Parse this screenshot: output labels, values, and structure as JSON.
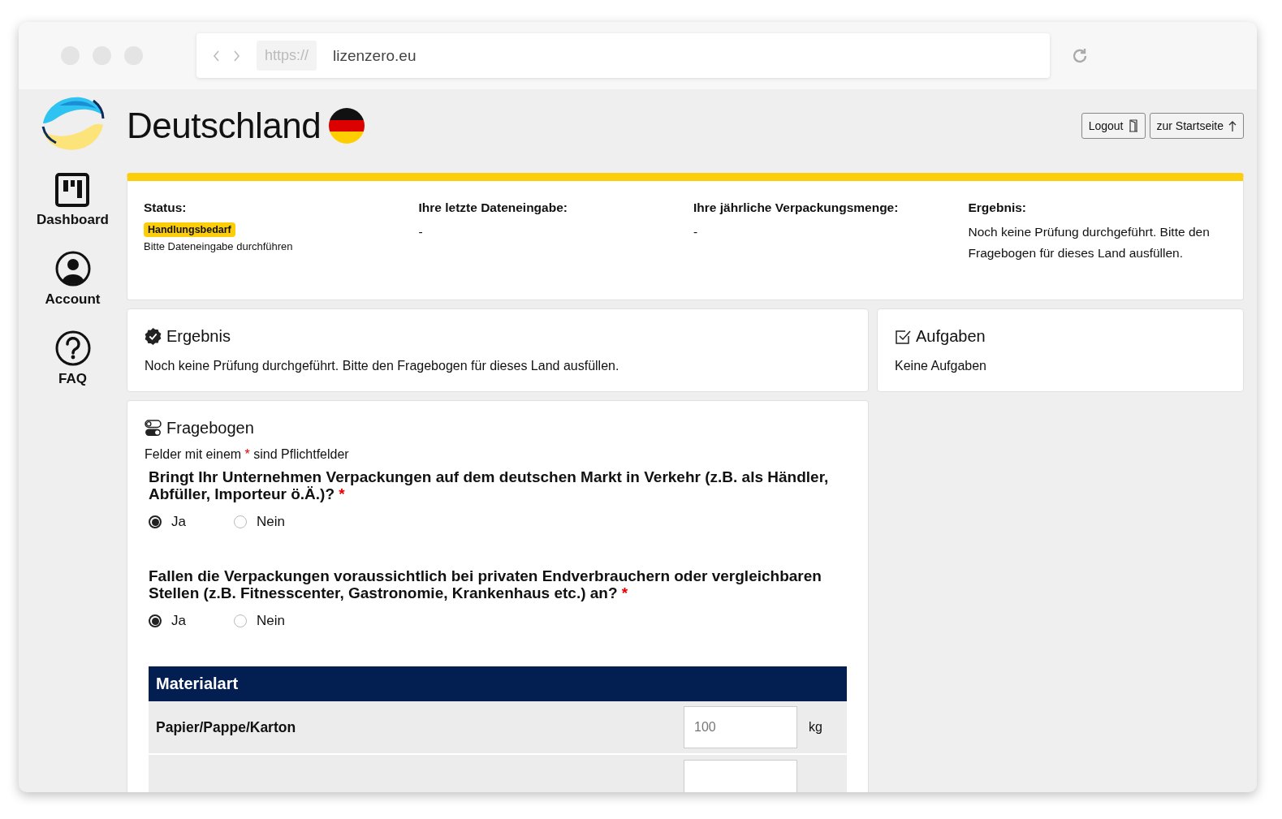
{
  "browser": {
    "scheme": "https://",
    "url": "lizenzero.eu"
  },
  "header": {
    "title": "Deutschland",
    "buttons": [
      {
        "label": "Logout",
        "kind": "logout"
      },
      {
        "label": "zur Startseite",
        "kind": "home"
      }
    ]
  },
  "sidebar": {
    "items": [
      {
        "label": "Dashboard",
        "kind": "dashboard"
      },
      {
        "label": "Account",
        "kind": "account"
      },
      {
        "label": "FAQ",
        "kind": "faq"
      }
    ]
  },
  "status": {
    "columns": [
      {
        "kind": "status",
        "heading": "Status:",
        "badge": "Handlungsbedarf",
        "note": "Bitte Dateneingabe durchführen"
      },
      {
        "kind": "text",
        "heading": "Ihre letzte Dateneingabe:",
        "text": "-"
      },
      {
        "kind": "text",
        "heading": "Ihre jährliche Verpackungsmenge:",
        "text": "-"
      },
      {
        "kind": "text",
        "heading": "Ergebnis:",
        "text": "Noch keine Prüfung durchgeführt. Bitte den Fragebogen für dieses Land ausfüllen."
      }
    ]
  },
  "result": {
    "title": "Ergebnis",
    "text": "Noch keine Prüfung durchgeführt. Bitte den Fragebogen für dieses Land ausfüllen."
  },
  "tasks": {
    "title": "Aufgaben",
    "text": "Keine Aufgaben"
  },
  "questionnaire": {
    "title": "Fragebogen",
    "hint_before": "Felder mit einem",
    "hint_mark": "*",
    "hint_after": "sind Pflichtfelder",
    "questions": [
      {
        "text": "Bringt Ihr Unternehmen Verpackungen auf dem deutschen Markt in Verkehr (z.B. als Händler, Abfüller, Importeur ö.Ä.)?",
        "required_mark": "*",
        "options": [
          {
            "label": "Ja",
            "selected": true
          },
          {
            "label": "Nein",
            "selected": false
          }
        ]
      },
      {
        "text": "Fallen die Verpackungen voraussichtlich bei privaten Endverbrauchern oder vergleichbaren Stellen (z.B. Fitnesscenter, Gastronomie, Krankenhaus etc.) an?",
        "required_mark": "*",
        "options": [
          {
            "label": "Ja",
            "selected": true
          },
          {
            "label": "Nein",
            "selected": false
          }
        ]
      }
    ],
    "table": {
      "header": "Materialart",
      "rows": [
        {
          "material": "Papier/Pappe/Karton",
          "placeholder": "100",
          "unit": "kg"
        }
      ]
    }
  }
}
